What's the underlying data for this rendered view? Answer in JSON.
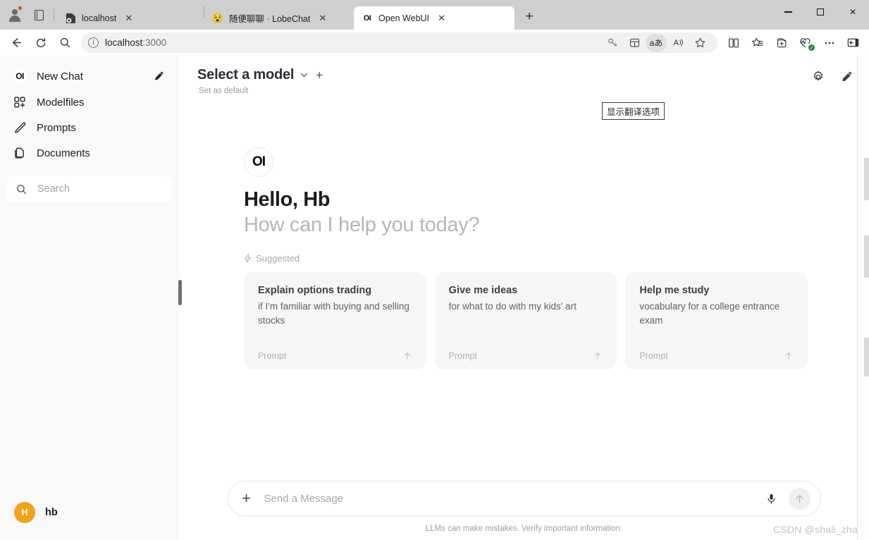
{
  "browser": {
    "profile": {
      "name": "profile-avatar",
      "has_notification": true
    },
    "tabs": [
      {
        "title": "localhost",
        "favicon": "document-icon",
        "active": false
      },
      {
        "title": "随便聊聊 · LobeChat",
        "favicon": "😵",
        "active": false
      },
      {
        "title": "Open WebUI",
        "favicon": "OI",
        "active": true
      }
    ],
    "new_tab_label": "+",
    "window_controls": {
      "minimize": "minimize",
      "maximize": "maximize",
      "close": "✕"
    },
    "nav": {
      "back": "back-arrow",
      "reload": "reload",
      "search": "search"
    },
    "address": {
      "value": "localhost:3000",
      "host": "localhost",
      "port": ":3000",
      "security_icon": "info-icon"
    },
    "omnibox_actions": [
      "key-icon",
      "split-grid-icon",
      "aあ",
      "read-aloud-icon",
      "favorite-star-icon"
    ],
    "toolbar_right": [
      "split-screen-icon",
      "collections-icon",
      "add-to-collection-icon",
      "browser-essentials-icon",
      "settings-more-icon",
      "sidebar-toggle-icon"
    ]
  },
  "sidebar": {
    "items": [
      {
        "label": "New Chat",
        "icon": "oi-logo-icon"
      },
      {
        "label": "Modelfiles",
        "icon": "modelfiles-grid-icon"
      },
      {
        "label": "Prompts",
        "icon": "pencil-icon"
      },
      {
        "label": "Documents",
        "icon": "documents-icon"
      }
    ],
    "new_chat_edit_icon": "compose-icon",
    "search": {
      "placeholder": "Search",
      "icon": "search-icon"
    },
    "user": {
      "name": "hb",
      "initial": "H",
      "avatar_color": "#f0a318"
    }
  },
  "main": {
    "model_selector": {
      "label": "Select a model",
      "chevron": "⌄",
      "add": "+",
      "set_default": "Set as default"
    },
    "tooltip": "显示翻译选项",
    "header_icons": [
      {
        "name": "settings-gear-icon",
        "glyph": "gear"
      },
      {
        "name": "new-chat-compose-icon",
        "glyph": "compose"
      }
    ],
    "greeting": {
      "logo": "OI",
      "name": "Hello, Hb",
      "question": "How can I help you today?"
    },
    "suggested": {
      "label": "Suggested",
      "icon": "lightning-icon",
      "cards": [
        {
          "title": "Explain options trading",
          "subtitle": "if I'm familiar with buying and selling stocks",
          "footer": "Prompt",
          "arrow": "↑"
        },
        {
          "title": "Give me ideas",
          "subtitle": "for what to do with my kids' art",
          "footer": "Prompt",
          "arrow": "↑"
        },
        {
          "title": "Help me study",
          "subtitle": "vocabulary for a college entrance exam",
          "footer": "Prompt",
          "arrow": "↑"
        }
      ]
    },
    "composer": {
      "add_label": "+",
      "placeholder": "Send a Message",
      "value": "",
      "mic_icon": "microphone-icon",
      "send_icon": "send-arrow-icon"
    },
    "disclaimer": "LLMs can make mistakes. Verify important information.",
    "watermark": "CSDN @shali_zhao",
    "watermark_mark": "?"
  },
  "colors": {
    "accent_avatar": "#f0a318",
    "sidebar_bg": "#f9f9f9",
    "card_bg": "#f6f6f6",
    "muted_text": "#b6b6b6"
  }
}
